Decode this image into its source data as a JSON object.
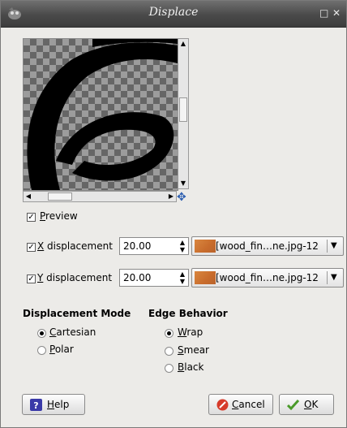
{
  "window": {
    "title": "Displace"
  },
  "titlebar": {
    "maximize_glyph": "□",
    "close_glyph": "✕"
  },
  "preview": {
    "label_prefix": "",
    "label_mnemonic": "P",
    "label_rest": "review",
    "checked": true
  },
  "x_displacement": {
    "mnemonic": "X",
    "rest": " displacement",
    "checked": true,
    "value": "20.00",
    "map": "[wood_fin…ne.jpg-12"
  },
  "y_displacement": {
    "mnemonic": "Y",
    "rest": " displacement",
    "checked": true,
    "value": "20.00",
    "map": "[wood_fin…ne.jpg-12"
  },
  "displacement_mode": {
    "heading": "Displacement Mode",
    "options": [
      {
        "mnemonic": "C",
        "rest": "artesian",
        "selected": true
      },
      {
        "mnemonic": "P",
        "rest": "olar",
        "selected": false
      }
    ]
  },
  "edge_behavior": {
    "heading": "Edge Behavior",
    "options": [
      {
        "mnemonic": "W",
        "rest": "rap",
        "selected": true
      },
      {
        "mnemonic": "S",
        "rest": "mear",
        "selected": false
      },
      {
        "mnemonic": "B",
        "rest": "lack",
        "selected": false
      }
    ]
  },
  "buttons": {
    "help": {
      "mnemonic": "H",
      "rest": "elp"
    },
    "cancel": {
      "mnemonic": "C",
      "rest": "ancel"
    },
    "ok": {
      "mnemonic": "O",
      "rest": "K"
    }
  },
  "icons": {
    "help": "help-icon",
    "cancel": "cancel-icon",
    "ok": "checkmark-icon",
    "navigate": "navigate-icon"
  },
  "colors": {
    "titlebar": "#4a4a4a",
    "swatch": "#c86c2c",
    "help_icon": "#3a3aa8",
    "cancel_icon": "#d63a2a",
    "ok_icon": "#4a9a2a"
  }
}
